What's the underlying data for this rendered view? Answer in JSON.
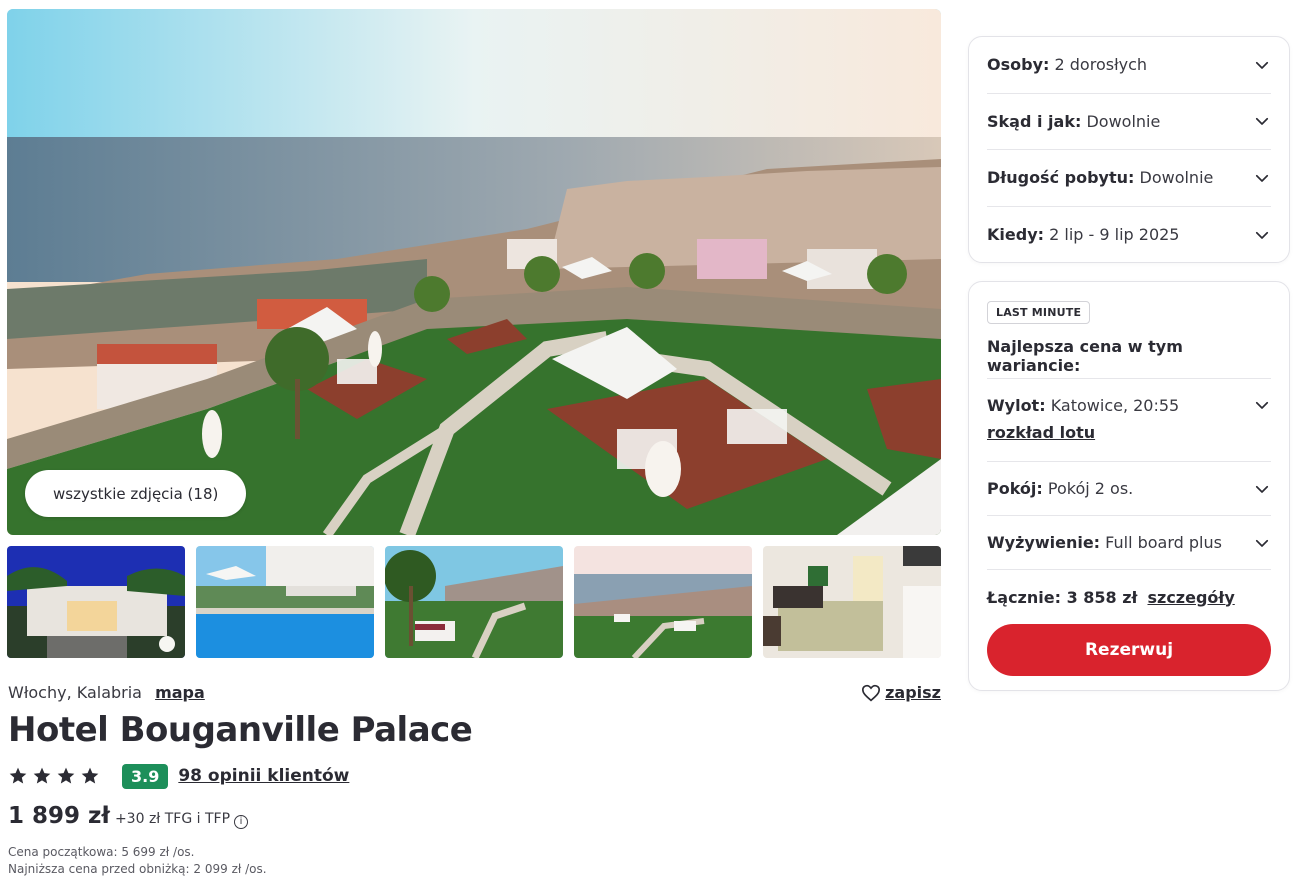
{
  "gallery": {
    "all_photos_label": "wszystkie zdjęcia (18)",
    "thumbnails": [
      {
        "icon": "thumbnail-hotel-night"
      },
      {
        "icon": "thumbnail-pool"
      },
      {
        "icon": "thumbnail-garden"
      },
      {
        "icon": "thumbnail-sea-view"
      },
      {
        "icon": "thumbnail-room"
      }
    ]
  },
  "location": {
    "text": "Włochy, Kalabria",
    "map_label": "mapa"
  },
  "save_label": "zapisz",
  "hotel": {
    "name": "Hotel Bouganville Palace",
    "stars": 4,
    "score": "3.9",
    "reviews_label": "98 opinii klientów"
  },
  "price": {
    "main": "1 899 zł",
    "extra": "+30 zł TFG i TFP",
    "initial_price": "Cena początkowa: 5 699 zł /os.",
    "lowest_before_discount": "Najniższa cena przed obniżką: 2 099 zł /os."
  },
  "search": {
    "persons_label": "Osoby:",
    "persons_value": "2 dorosłych",
    "from_label": "Skąd i jak:",
    "from_value": "Dowolnie",
    "length_label": "Długość pobytu:",
    "length_value": "Dowolnie",
    "when_label": "Kiedy:",
    "when_value": "2 lip - 9 lip 2025"
  },
  "offer": {
    "badge": "LAST MINUTE",
    "best_price_label": "Najlepsza cena w tym wariancie:",
    "departure_label": "Wylot:",
    "departure_value": "Katowice, 20:55",
    "flight_schedule_label": "rozkład lotu",
    "room_label": "Pokój:",
    "room_value": "Pokój 2 os.",
    "board_label": "Wyżywienie:",
    "board_value": "Full board plus",
    "total_label": "Łącznie: 3 858 zł",
    "details_label": "szczegóły",
    "book_label": "Rezerwuj"
  },
  "colors": {
    "accent_red": "#d9232d",
    "score_green": "#1d8f5a",
    "text_dark": "#2b2b33"
  }
}
